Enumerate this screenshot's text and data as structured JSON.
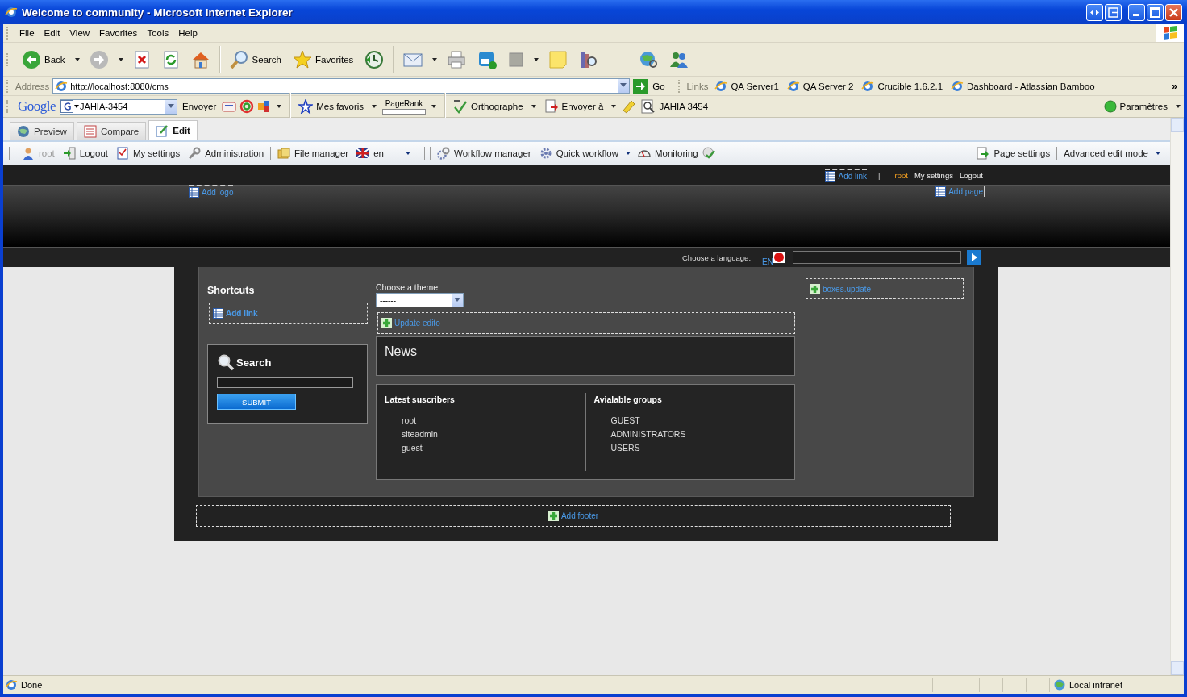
{
  "window": {
    "title": "Welcome to community - Microsoft Internet Explorer"
  },
  "menu_bar": [
    "File",
    "Edit",
    "View",
    "Favorites",
    "Tools",
    "Help"
  ],
  "toolbar": [
    {
      "label": "Back",
      "dropdown": true
    },
    {
      "dropdown": true
    },
    {
      "label": "Search",
      "dropdown": false
    },
    {
      "label": "Favorites",
      "dropdown": false
    }
  ],
  "address_bar": {
    "label": "Address",
    "value": "http://localhost:8080/cms",
    "go": "Go"
  },
  "links": {
    "label": "Links",
    "items": [
      "QA Server1",
      "QA Server 2",
      "Crucible 1.6.2.1",
      "Dashboard - Atlassian Bamboo"
    ],
    "more": "»"
  },
  "google_bar": {
    "logo": "Google",
    "query": "JAHIA-3454",
    "send": "Envoyer",
    "favorites": "Mes favoris",
    "pagerank": "PageRank",
    "spelling": "Orthographe",
    "send_to": "Envoyer à",
    "search_term": "JAHIA 3454",
    "settings": "Paramètres"
  },
  "tabs": [
    {
      "label": "Preview",
      "selected": false
    },
    {
      "label": "Compare",
      "selected": false
    },
    {
      "label": "Edit",
      "selected": true
    }
  ],
  "edit_toolbar": {
    "items": [
      {
        "label": "root",
        "disabled": true,
        "dropdown": false
      },
      {
        "label": "Logout",
        "disabled": false,
        "dropdown": false
      },
      {
        "label": "My settings",
        "disabled": false,
        "dropdown": false
      },
      {
        "label": "Administration",
        "disabled": false,
        "dropdown": false
      },
      {
        "label": "File manager",
        "disabled": false,
        "dropdown": false
      },
      {
        "label": "en",
        "disabled": false,
        "dropdown": true
      },
      {
        "label": "Workflow manager",
        "disabled": false,
        "dropdown": false
      },
      {
        "label": "Quick workflow",
        "disabled": false,
        "dropdown": true
      },
      {
        "label": "Monitoring",
        "disabled": false,
        "dropdown": false
      }
    ],
    "right": [
      {
        "label": "Page settings",
        "dropdown": false
      },
      {
        "label": "Advanced edit mode",
        "dropdown": true
      }
    ]
  },
  "top_links": {
    "add_link": "Add link",
    "separator": "|",
    "user": "root",
    "settings": "My settings",
    "logout": "Logout"
  },
  "header": {
    "add_logo": "Add logo",
    "add_page": "Add page"
  },
  "language_bar": {
    "label": "Choose a language:",
    "language": "EN"
  },
  "shortcuts": {
    "title": "Shortcuts",
    "add_link": "Add link"
  },
  "search_box": {
    "title": "Search",
    "button": "SUBMIT"
  },
  "theme": {
    "label": "Choose a theme:",
    "value": "------"
  },
  "update_edito": "Update edito",
  "news": {
    "title": "News"
  },
  "subscribers": {
    "title": "Latest suscribers",
    "items": [
      "root",
      "siteadmin",
      "guest"
    ]
  },
  "groups": {
    "title": "Avialable groups",
    "items": [
      "GUEST",
      "ADMINISTRATORS",
      "USERS"
    ]
  },
  "boxes_update": "boxes.update",
  "add_footer": "Add footer",
  "status_bar": {
    "text": "Done",
    "zone": "Local intranet"
  }
}
